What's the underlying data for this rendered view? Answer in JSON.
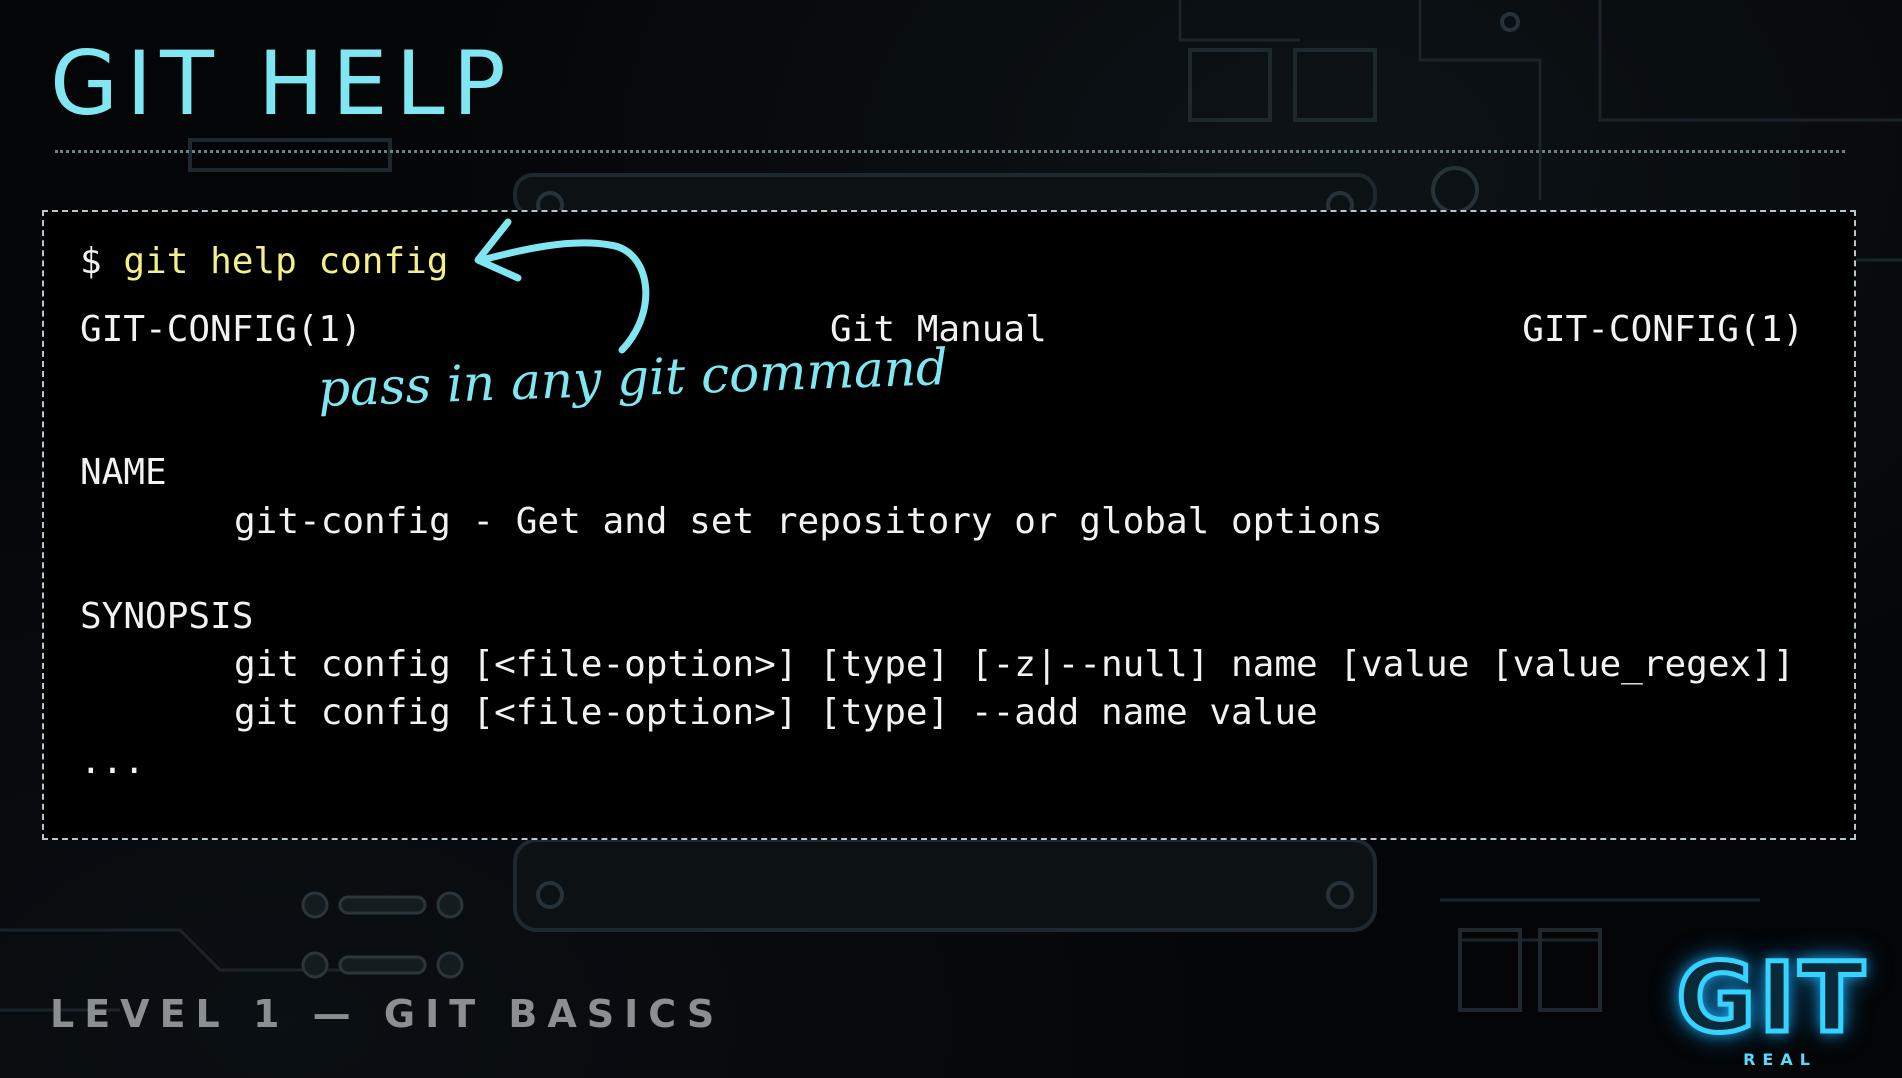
{
  "slide": {
    "title": "GIT HELP",
    "footer": "LEVEL 1 — GIT BASICS",
    "logo": {
      "word": "GIT",
      "sub": "REAL"
    }
  },
  "terminal": {
    "prompt_symbol": "$",
    "command": "git help config",
    "header": {
      "left": "GIT-CONFIG(1)",
      "center": "Git Manual",
      "right": "GIT-CONFIG(1)"
    },
    "sections": {
      "name_heading": "NAME",
      "name_description": "git-config - Get and set repository or global options",
      "synopsis_heading": "SYNOPSIS",
      "synopsis_lines": [
        "git config [<file-option>] [type] [-z|--null] name [value [value_regex]]",
        "git config [<file-option>] [type] --add name value"
      ]
    },
    "continuation": "..."
  },
  "annotation": {
    "text": "pass in any git command",
    "icon": "curved-arrow-icon"
  },
  "colors": {
    "accent": "#7fe6f2",
    "command": "#f3f08a",
    "terminal_text": "#f2f2f2",
    "logo_glow": "#35d3ff"
  }
}
